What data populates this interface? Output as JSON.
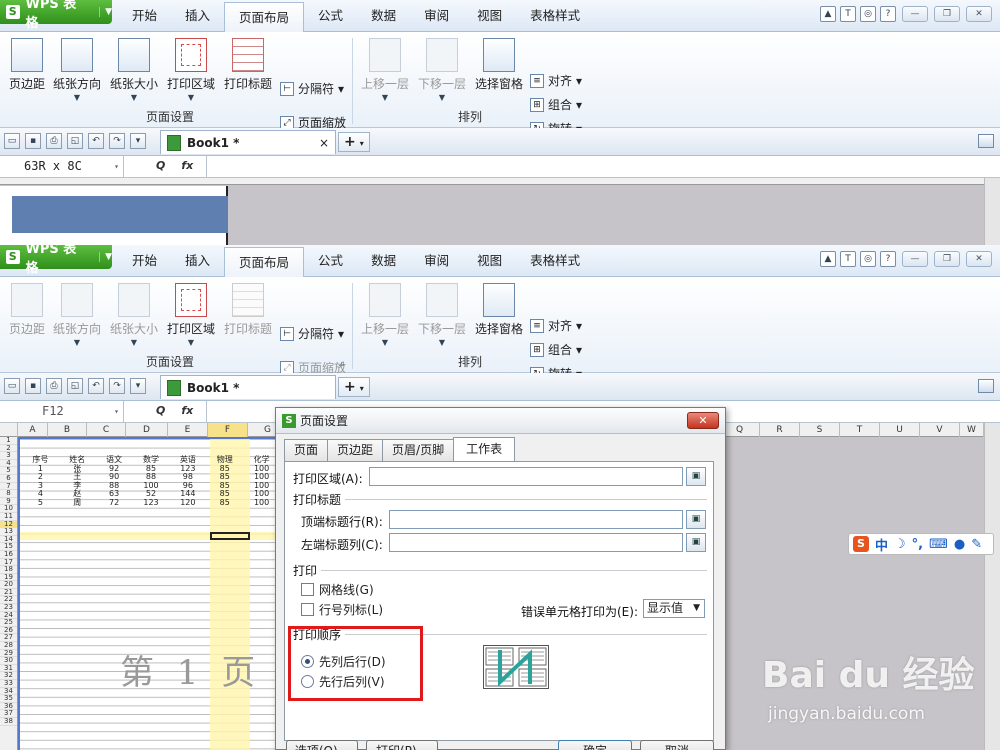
{
  "app": {
    "logo": "WPS 表格",
    "menus": [
      "开始",
      "插入",
      "页面布局",
      "公式",
      "数据",
      "审阅",
      "视图",
      "表格样式"
    ],
    "active_menu": "页面布局"
  },
  "ribbon_top": {
    "page_setup_buttons": [
      "页边距",
      "纸张方向",
      "纸张大小",
      "打印区域",
      "打印标题"
    ],
    "separator_label": "分隔符",
    "page_zoom_label": "页面缩放",
    "group_page_setup": "页面设置",
    "arrange_buttons": [
      "上移一层",
      "下移一层",
      "选择窗格"
    ],
    "align_label": "对齐",
    "group_label": "组合",
    "rotate_label": "旋转",
    "group_arrange": "排列"
  },
  "doc_tab": {
    "name": "Book1 *",
    "close": "×",
    "add": "+"
  },
  "top_window": {
    "name_box": "63R x 8C",
    "fx": "fx"
  },
  "bottom_window": {
    "name_box": "F12",
    "fx": "fx"
  },
  "sheet": {
    "columns": [
      "A",
      "B",
      "C",
      "D",
      "E",
      "F",
      "G",
      "Q",
      "R",
      "S",
      "T",
      "U",
      "V",
      "W"
    ],
    "header_row": [
      "序号",
      "姓名",
      "语文",
      "数学",
      "英语",
      "物理",
      "化学"
    ],
    "data_rows": [
      [
        "1",
        "张",
        "92",
        "85",
        "123",
        "85",
        "100"
      ],
      [
        "2",
        "王",
        "90",
        "88",
        "98",
        "85",
        "100"
      ],
      [
        "3",
        "李",
        "88",
        "100",
        "96",
        "85",
        "100"
      ],
      [
        "4",
        "赵",
        "63",
        "52",
        "144",
        "85",
        "100"
      ],
      [
        "5",
        "周",
        "72",
        "123",
        "120",
        "85",
        "100"
      ]
    ],
    "row_numbers": [
      "1",
      "2",
      "3",
      "4",
      "5",
      "6",
      "7",
      "8",
      "9",
      "10",
      "11",
      "12",
      "13",
      "14",
      "15",
      "16",
      "17",
      "18",
      "19",
      "20",
      "21",
      "22",
      "23",
      "24",
      "25",
      "26",
      "27",
      "28",
      "29",
      "30",
      "31",
      "32",
      "33",
      "34",
      "35",
      "36",
      "37",
      "38"
    ],
    "page_watermark": "第 1 页"
  },
  "dialog": {
    "title": "页面设置",
    "close": "✕",
    "tabs": [
      "页面",
      "页边距",
      "页眉/页脚",
      "工作表"
    ],
    "active_tab": "工作表",
    "print_area_label": "打印区域(A):",
    "print_title_section": "打印标题",
    "top_rows_label": "顶端标题行(R):",
    "left_cols_label": "左端标题列(C):",
    "print_section": "打印",
    "gridlines_label": "网格线(G)",
    "row_col_headers_label": "行号列标(L)",
    "error_cells_label": "错误单元格打印为(E):",
    "error_cells_value": "显示值",
    "print_order_section": "打印顺序",
    "order_options": [
      "先列后行(D)",
      "先行后列(V)"
    ],
    "selected_order": "先列后行(D)",
    "buttons": [
      "选项(O)...",
      "打印(P)...",
      "确定",
      "取消"
    ]
  },
  "ime": {
    "logo": "S",
    "mode": "中"
  },
  "watermark": {
    "brand": "Bai du 经验",
    "url": "jingyan.baidu.com"
  },
  "colors": {
    "highlight_box": "#e01a1a",
    "wps_green": "#2f8f1c",
    "selection_blue": "#5f7fb0"
  }
}
